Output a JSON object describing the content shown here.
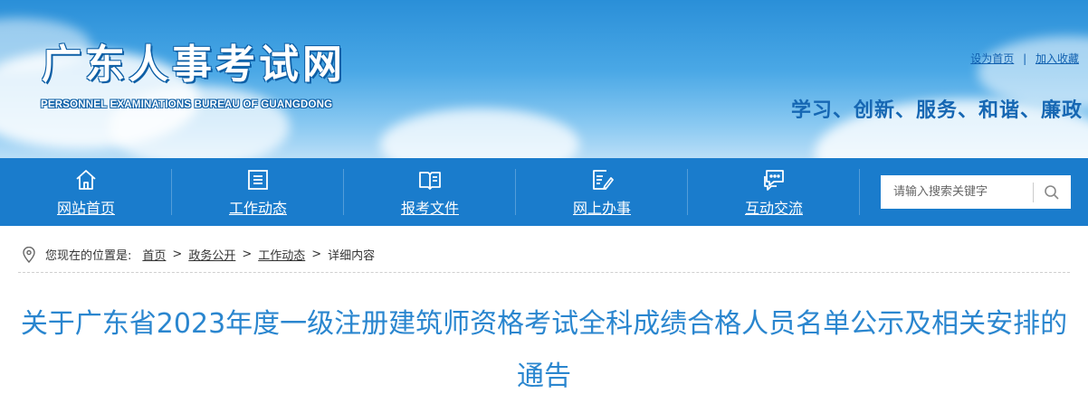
{
  "header": {
    "site_title": "广东人事考试网",
    "site_subtitle": "PERSONNEL EXAMINATIONS BUREAU OF GUANGDONG",
    "top_links": {
      "set_home": "设为首页",
      "separator": "|",
      "add_favorite": "加入收藏"
    },
    "slogan": "学习、创新、服务、和谐、廉政"
  },
  "nav": {
    "items": [
      {
        "label": "网站首页",
        "icon": "home-icon"
      },
      {
        "label": "工作动态",
        "icon": "news-list-icon"
      },
      {
        "label": "报考文件",
        "icon": "open-book-icon"
      },
      {
        "label": "网上办事",
        "icon": "edit-document-icon"
      },
      {
        "label": "互动交流",
        "icon": "chat-bubbles-icon"
      }
    ],
    "search": {
      "placeholder": "请输入搜索关键字",
      "icon": "search-icon"
    }
  },
  "breadcrumb": {
    "prefix": "您现在的位置是:",
    "items": [
      "首页",
      "政务公开",
      "工作动态"
    ],
    "current": "详细内容",
    "separator": ">"
  },
  "article": {
    "title": "关于广东省2023年度一级注册建筑师资格考试全科成绩合格人员名单公示及相关安排的通告"
  },
  "colors": {
    "nav_bg": "#1a7ccc",
    "title_color": "#2a86cf",
    "slogan_color": "#1667b3",
    "link_color": "#1060b0"
  }
}
